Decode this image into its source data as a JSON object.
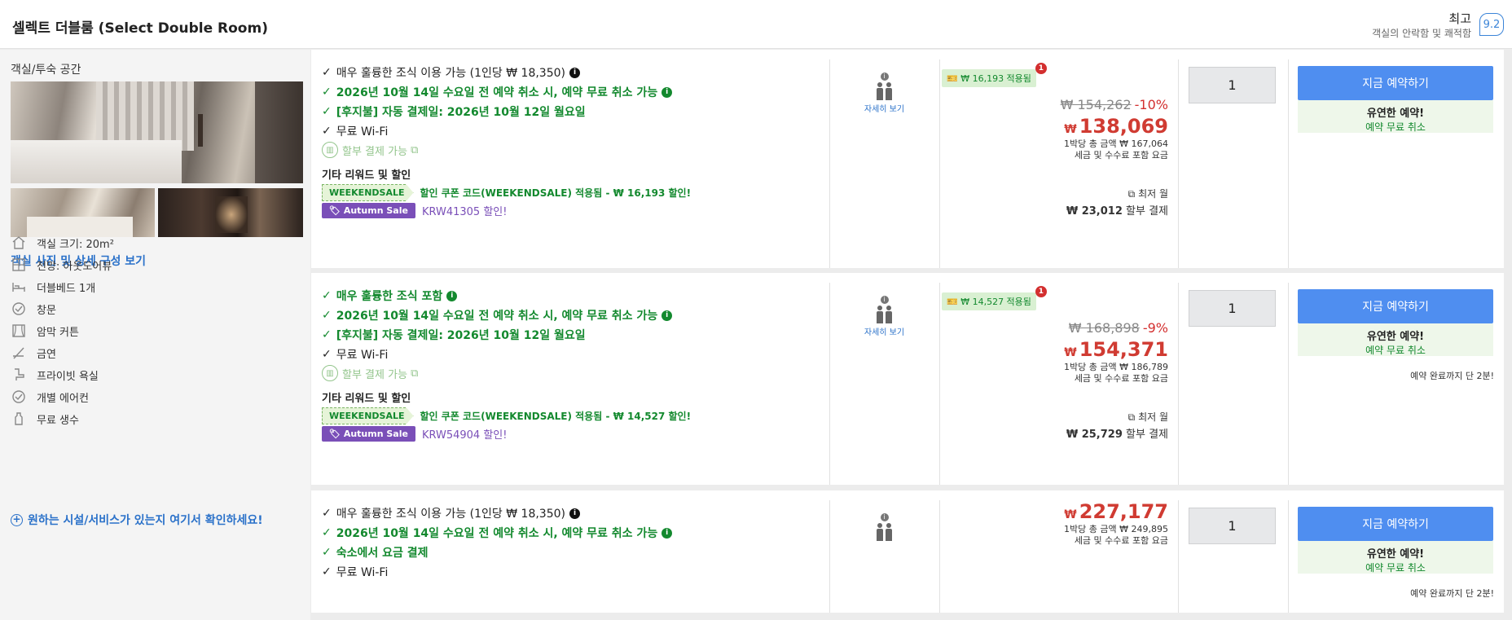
{
  "header": {
    "room_title": "셀렉트 더블룸 (Select Double Room)",
    "rating_word": "최고",
    "rating_sub": "객실의 안락함 및 쾌적함",
    "rating_score": "9.2"
  },
  "left": {
    "section_title": "객실/투숙 공간",
    "photos_link": "객실 사진 및 상세 구성 보기",
    "features": [
      {
        "icon": "room-size-icon",
        "label": "객실 크기: 20m²"
      },
      {
        "icon": "view-icon",
        "label": "전망: 아웃도어뷰"
      },
      {
        "icon": "bed-icon",
        "label": "더블베드 1개"
      },
      {
        "icon": "window-icon",
        "label": "창문"
      },
      {
        "icon": "blackout-curtain-icon",
        "label": "암막 커튼"
      },
      {
        "icon": "no-smoking-icon",
        "label": "금연"
      },
      {
        "icon": "private-bathroom-icon",
        "label": "프라이빗 욕실"
      },
      {
        "icon": "air-conditioner-icon",
        "label": "개별 에어컨"
      },
      {
        "icon": "water-bottle-icon",
        "label": "무료 생수"
      }
    ],
    "facilities_link": "원하는 시설/서비스가 있는지 여기서 확인하세요!"
  },
  "offers": [
    {
      "benefits": [
        {
          "style": "black",
          "text": "매우 훌륭한 조식 이용 가능 (1인당 ₩ 18,350)",
          "info": true
        },
        {
          "style": "green",
          "text": "2026년 10월 14일 수요일 전 예약 취소 시, 예약 무료 취소 가능",
          "info": true
        },
        {
          "style": "green",
          "text": "[후지불] 자동 결제일: 2026년 10월 12일 월요일",
          "info": false
        },
        {
          "style": "black",
          "text": "무료 Wi-Fi",
          "info": false
        }
      ],
      "installment": "할부 결제 가능",
      "reward_title": "기타 리워드 및 할인",
      "coupon_tag": "WEEKENDSALE",
      "coupon_text": "할인 쿠폰 코드(WEEKENDSALE) 적용됨 - ₩ 16,193 할인!",
      "autumn_tag": "Autumn Sale",
      "autumn_text": "KRW41305 할인!",
      "occupancy_more": "자세히 보기",
      "promo_text": "₩ 16,193 적용됨",
      "promo_badge": "1",
      "original_price": "₩ 154,262",
      "discount": "-10%",
      "currency": "₩",
      "final_price": "138,069",
      "total_line1": "1박당 총 금액 ₩ 167,064",
      "total_line2": "세금 및 수수료 포함 요금",
      "lowest_label": "최저 월",
      "monthly_amount": "₩ 23,012",
      "monthly_label": "할부 결제",
      "quantity": "1",
      "book_label": "지금 예약하기",
      "flex_title": "유연한 예약!",
      "flex_sub": "예약 무료 취소",
      "hurry": ""
    },
    {
      "benefits": [
        {
          "style": "green",
          "text": "매우 훌륭한 조식 포함",
          "info": true
        },
        {
          "style": "green",
          "text": "2026년 10월 14일 수요일 전 예약 취소 시, 예약 무료 취소 가능",
          "info": true
        },
        {
          "style": "green",
          "text": "[후지불] 자동 결제일: 2026년 10월 12일 월요일",
          "info": false
        },
        {
          "style": "black",
          "text": "무료 Wi-Fi",
          "info": false
        }
      ],
      "installment": "할부 결제 가능",
      "reward_title": "기타 리워드 및 할인",
      "coupon_tag": "WEEKENDSALE",
      "coupon_text": "할인 쿠폰 코드(WEEKENDSALE) 적용됨 - ₩ 14,527 할인!",
      "autumn_tag": "Autumn Sale",
      "autumn_text": "KRW54904 할인!",
      "occupancy_more": "자세히 보기",
      "promo_text": "₩ 14,527 적용됨",
      "promo_badge": "1",
      "original_price": "₩ 168,898",
      "discount": "-9%",
      "currency": "₩",
      "final_price": "154,371",
      "total_line1": "1박당 총 금액 ₩ 186,789",
      "total_line2": "세금 및 수수료 포함 요금",
      "lowest_label": "최저 월",
      "monthly_amount": "₩ 25,729",
      "monthly_label": "할부 결제",
      "quantity": "1",
      "book_label": "지금 예약하기",
      "flex_title": "유연한 예약!",
      "flex_sub": "예약 무료 취소",
      "hurry": "예약 완료까지 단 2분!"
    },
    {
      "benefits": [
        {
          "style": "black",
          "text": "매우 훌륭한 조식 이용 가능 (1인당 ₩ 18,350)",
          "info": true
        },
        {
          "style": "green",
          "text": "2026년 10월 14일 수요일 전 예약 취소 시, 예약 무료 취소 가능",
          "info": true
        },
        {
          "style": "green",
          "text": "숙소에서 요금 결제",
          "info": false
        },
        {
          "style": "black",
          "text": "무료 Wi-Fi",
          "info": false
        }
      ],
      "currency": "₩",
      "final_price": "227,177",
      "total_line1": "1박당 총 금액 ₩ 249,895",
      "total_line2": "세금 및 수수료 포함 요금",
      "quantity": "1",
      "book_label": "지금 예약하기",
      "flex_title": "유연한 예약!",
      "flex_sub": "예약 무료 취소",
      "hurry": "예약 완료까지 단 2분!"
    }
  ]
}
